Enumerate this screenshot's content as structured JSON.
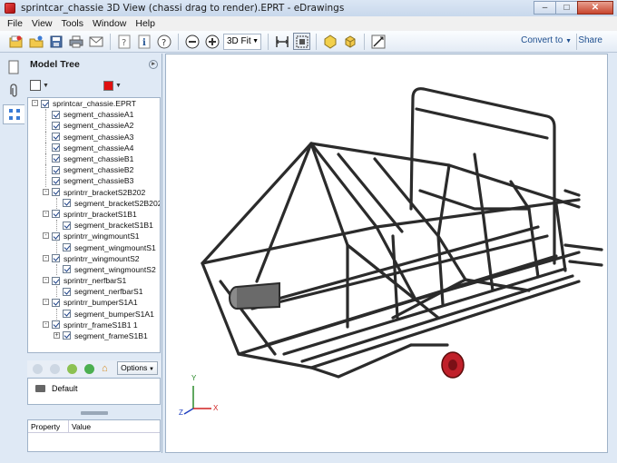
{
  "window": {
    "title": "sprintcar_chassie 3D View (chassi drag to render).EPRT - eDrawings",
    "min": "–",
    "max": "□",
    "close": "✕"
  },
  "menu": [
    "File",
    "View",
    "Tools",
    "Window",
    "Help"
  ],
  "toolbar": {
    "fit_label": "3D Fit",
    "convert_label": "Convert to",
    "share_label": "Share"
  },
  "panel": {
    "title": "Model Tree"
  },
  "tree": [
    {
      "label": "sprintcar_chassie.EPRT",
      "level": 0,
      "expander": "-"
    },
    {
      "label": "segment_chassieA1",
      "level": 1,
      "expander": ""
    },
    {
      "label": "segment_chassieA2",
      "level": 1,
      "expander": ""
    },
    {
      "label": "segment_chassieA3",
      "level": 1,
      "expander": ""
    },
    {
      "label": "segment_chassieA4",
      "level": 1,
      "expander": ""
    },
    {
      "label": "segment_chassieB1",
      "level": 1,
      "expander": ""
    },
    {
      "label": "segment_chassieB2",
      "level": 1,
      "expander": ""
    },
    {
      "label": "segment_chassieB3",
      "level": 1,
      "expander": ""
    },
    {
      "label": "sprintrr_bracketS2B202",
      "level": 1,
      "expander": "-"
    },
    {
      "label": "segment_bracketS2B202",
      "level": 2,
      "expander": ""
    },
    {
      "label": "sprintrr_bracketS1B1",
      "level": 1,
      "expander": "-"
    },
    {
      "label": "segment_bracketS1B1",
      "level": 2,
      "expander": ""
    },
    {
      "label": "sprintrr_wingmountS1",
      "level": 1,
      "expander": "-"
    },
    {
      "label": "segment_wingmountS1",
      "level": 2,
      "expander": ""
    },
    {
      "label": "sprintrr_wingmountS2",
      "level": 1,
      "expander": "-"
    },
    {
      "label": "segment_wingmountS2",
      "level": 2,
      "expander": ""
    },
    {
      "label": "sprintrr_nerfbarS1",
      "level": 1,
      "expander": "-"
    },
    {
      "label": "segment_nerfbarS1",
      "level": 2,
      "expander": ""
    },
    {
      "label": "sprintrr_bumperS1A1",
      "level": 1,
      "expander": "-"
    },
    {
      "label": "segment_bumperS1A1",
      "level": 2,
      "expander": ""
    },
    {
      "label": "sprintrr_frameS1B1  1",
      "level": 1,
      "expander": "-"
    },
    {
      "label": "segment_frameS1B1",
      "level": 2,
      "expander": "+"
    }
  ],
  "nav": {
    "options_label": "Options"
  },
  "config": {
    "default_label": "Default"
  },
  "props": {
    "col1": "Property",
    "col2": "Value"
  },
  "triad": {
    "x": "X",
    "y": "Y",
    "z": "Z"
  },
  "colors": {
    "accent": "#1e4f8f",
    "swatch": "#e01010"
  }
}
